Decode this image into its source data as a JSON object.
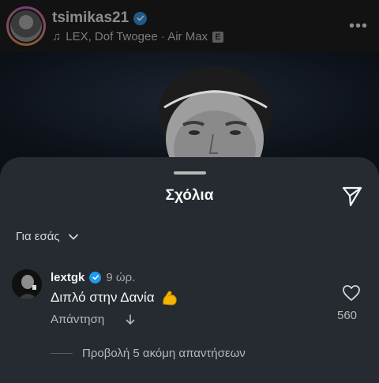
{
  "post": {
    "username": "tsimikas21",
    "music": "LEX, Dof Twogee · Air Max",
    "explicit_badge": "E"
  },
  "comments_sheet": {
    "title": "Σχόλια",
    "filter_label": "Για εσάς",
    "comment": {
      "username": "lextgk",
      "time": "9 ώρ.",
      "text": "Διπλό στην Δανία",
      "reply_label": "Απάντηση",
      "like_count": "560"
    },
    "view_replies_label": "Προβολή 5 ακόμη απαντήσεων"
  },
  "icons": {
    "verified": "verified-badge-icon",
    "music": "music-note-icon",
    "more": "more-options-icon",
    "share": "send-icon",
    "chevron": "chevron-down-icon",
    "emoji": "flexed-biceps-emoji",
    "translate": "arrow-down-icon",
    "like": "heart-icon"
  },
  "colors": {
    "sheet_background": "#262a31",
    "verified_blue": "#1d9bf0",
    "emoji_yellow": "#f5b400"
  }
}
